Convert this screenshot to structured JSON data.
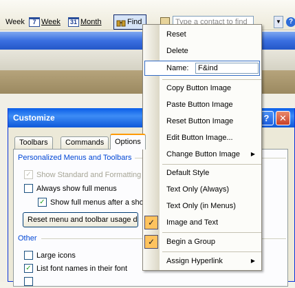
{
  "toolbar": {
    "week_7_label": "Week",
    "week_7_num": "7",
    "week_label": "Week",
    "month_num": "31",
    "month_label": "Month",
    "find_label": "Find",
    "contact_placeholder": "Type a contact to find"
  },
  "dialog": {
    "title": "Customize",
    "tabs": [
      "Toolbars",
      "Commands",
      "Options"
    ],
    "personalized_header": "Personalized Menus and Toolbars",
    "show_standard": "Show Standard and Formatting toolbars on two rows",
    "always_show": "Always show full menus",
    "show_full_after": "Show full menus after a short delay",
    "reset_button": "Reset menu and toolbar usage data",
    "other_header": "Other",
    "large_icons": "Large icons",
    "list_fonts": "List font names in their font"
  },
  "menu": {
    "reset": "Reset",
    "delete": "Delete",
    "name_label": "Name:",
    "name_value": "F&ind",
    "copy_image": "Copy Button Image",
    "paste_image": "Paste Button Image",
    "reset_image": "Reset Button Image",
    "edit_image": "Edit Button Image...",
    "change_image": "Change Button Image",
    "default_style": "Default Style",
    "text_only_always": "Text Only (Always)",
    "text_only_menus": "Text Only (in Menus)",
    "image_and_text": "Image and Text",
    "begin_group": "Begin a Group",
    "assign_hyperlink": "Assign Hyperlink"
  },
  "icons": {
    "check": "check-icon",
    "submenu": "submenu-arrow-icon",
    "find": "binoculars-icon",
    "address_book": "address-book-icon",
    "help": "help-icon",
    "close": "close-icon",
    "calendar": "calendar-icon"
  },
  "colors": {
    "title_blue": "#0a5ee8",
    "menu_check_bg": "#ffc35e",
    "group_header": "#0046d5"
  }
}
